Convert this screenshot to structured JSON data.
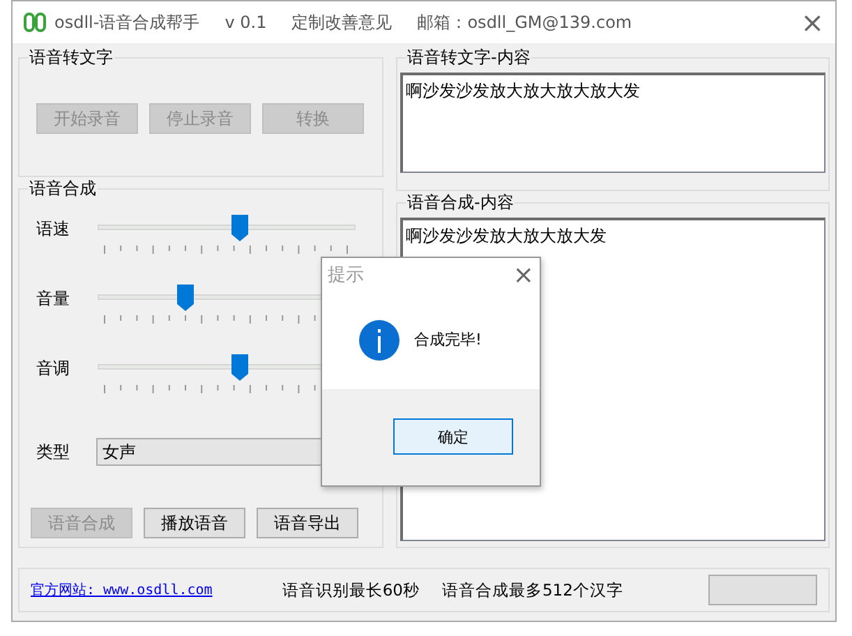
{
  "window": {
    "title": "osdll-语音合成帮手",
    "version": "v 0.1",
    "feedback": "定制改善意见",
    "email": "邮箱：osdll_GM@139.com",
    "close": "×"
  },
  "speech_to_text": {
    "title": "语音转文字",
    "buttons": [
      {
        "label": "开始录音",
        "disabled": true
      },
      {
        "label": "停止录音",
        "disabled": true
      },
      {
        "label": "转换",
        "disabled": true
      }
    ]
  },
  "synthesis": {
    "title": "语音合成",
    "sliders": [
      {
        "label": "语速",
        "level": 0.55
      },
      {
        "label": "音量",
        "level": 0.34
      },
      {
        "label": "音调",
        "level": 0.55
      }
    ],
    "type_label": "类型",
    "type_value": "女声",
    "buttons": [
      {
        "label": "语音合成",
        "disabled": true
      },
      {
        "label": "播放语音",
        "disabled": false
      },
      {
        "label": "语音导出",
        "disabled": false
      }
    ]
  },
  "stt_content": {
    "title": "语音转文字-内容",
    "text": "啊沙发沙发放大放大放大放大发"
  },
  "synthesis_content": {
    "title": "语音合成-内容",
    "text": "啊沙发沙发放大放大放大发"
  },
  "status_bar": {
    "link": "官方网站: www.osdll.com",
    "items": [
      "语音识别最长60秒",
      "语音合成最多512个汉字"
    ]
  },
  "dialog": {
    "title": "提示",
    "close": "×",
    "message": "合成完毕!",
    "button": "确定"
  }
}
